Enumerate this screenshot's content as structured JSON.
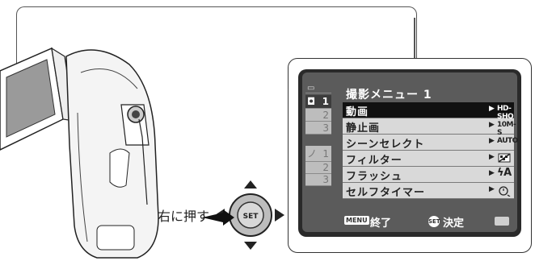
{
  "press_label": "右に押す",
  "dpad": {
    "center_label": "SET"
  },
  "menu": {
    "title": "撮影メニュー 1",
    "tabs": [
      {
        "icon": "photo-camera-icon",
        "number": "1",
        "active": true
      },
      {
        "number": "2",
        "active": false
      },
      {
        "number": "3",
        "active": false
      },
      {
        "icon": "wrench-icon",
        "number": "1",
        "active": false
      },
      {
        "number": "2",
        "active": false
      },
      {
        "number": "3",
        "active": false
      }
    ],
    "items": [
      {
        "label": "動画",
        "value": "HD-SHQ",
        "selected": true
      },
      {
        "label": "静止画",
        "value": "10M-S",
        "selected": false
      },
      {
        "label": "シーンセレクト",
        "value": "AUTO",
        "selected": false
      },
      {
        "label": "フィルター",
        "value": "",
        "selected": false
      },
      {
        "label": "フラッシュ",
        "value": "ϟA",
        "selected": false
      },
      {
        "label": "セルフタイマー",
        "value": "",
        "selected": false
      }
    ],
    "footer": {
      "menu_key": "MENU",
      "end_label": "終了",
      "set_key": "SET",
      "ok_label": "決定"
    }
  }
}
